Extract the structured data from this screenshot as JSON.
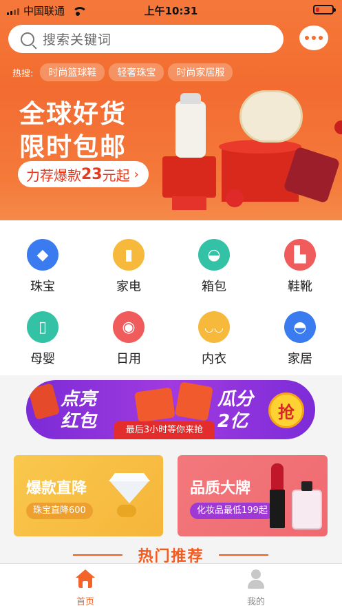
{
  "status_bar": {
    "carrier": "中国联通",
    "time": "上午10:31"
  },
  "search": {
    "placeholder": "搜索关键词"
  },
  "hot": {
    "label": "热搜:",
    "tags": [
      "时尚篮球鞋",
      "轻奢珠宝",
      "时尚家居服"
    ]
  },
  "banner": {
    "title_line1": "全球好货",
    "title_line2": "限时包邮",
    "pill_prefix": "力荐爆款",
    "pill_number": "23",
    "pill_suffix": "元起",
    "pill_arrow": "›"
  },
  "categories": [
    {
      "label": "珠宝",
      "icon": "diamond-icon",
      "color": "#3a7cf0",
      "glyph": "◆"
    },
    {
      "label": "家电",
      "icon": "fridge-icon",
      "color": "#f6b93b",
      "glyph": "▮"
    },
    {
      "label": "箱包",
      "icon": "bag-icon",
      "color": "#33c2a5",
      "glyph": "◒"
    },
    {
      "label": "鞋靴",
      "icon": "boot-icon",
      "color": "#f05b5b",
      "glyph": "▙"
    },
    {
      "label": "母婴",
      "icon": "baby-bottle-icon",
      "color": "#33c2a5",
      "glyph": "▯"
    },
    {
      "label": "日用",
      "icon": "tissue-icon",
      "color": "#f05b5b",
      "glyph": "◉"
    },
    {
      "label": "内衣",
      "icon": "underwear-icon",
      "color": "#f6b93b",
      "glyph": "◡◡"
    },
    {
      "label": "家居",
      "icon": "lamp-icon",
      "color": "#3a7cf0",
      "glyph": "◓"
    }
  ],
  "packet": {
    "left_line1": "点亮",
    "left_line2": "红包",
    "right_line1": "瓜分",
    "right_line2": "2亿",
    "button": "抢",
    "ribbon": "最后3小时等你来抢"
  },
  "promos": [
    {
      "title": "爆款直降",
      "tag": "珠宝直降600"
    },
    {
      "title": "品质大牌",
      "tag": "化妆品最低199起"
    }
  ],
  "recommend": {
    "title": "热门推荐"
  },
  "tabbar": {
    "home": "首页",
    "mine": "我的",
    "active_color": "#f2642a",
    "inactive_color": "#888888"
  }
}
